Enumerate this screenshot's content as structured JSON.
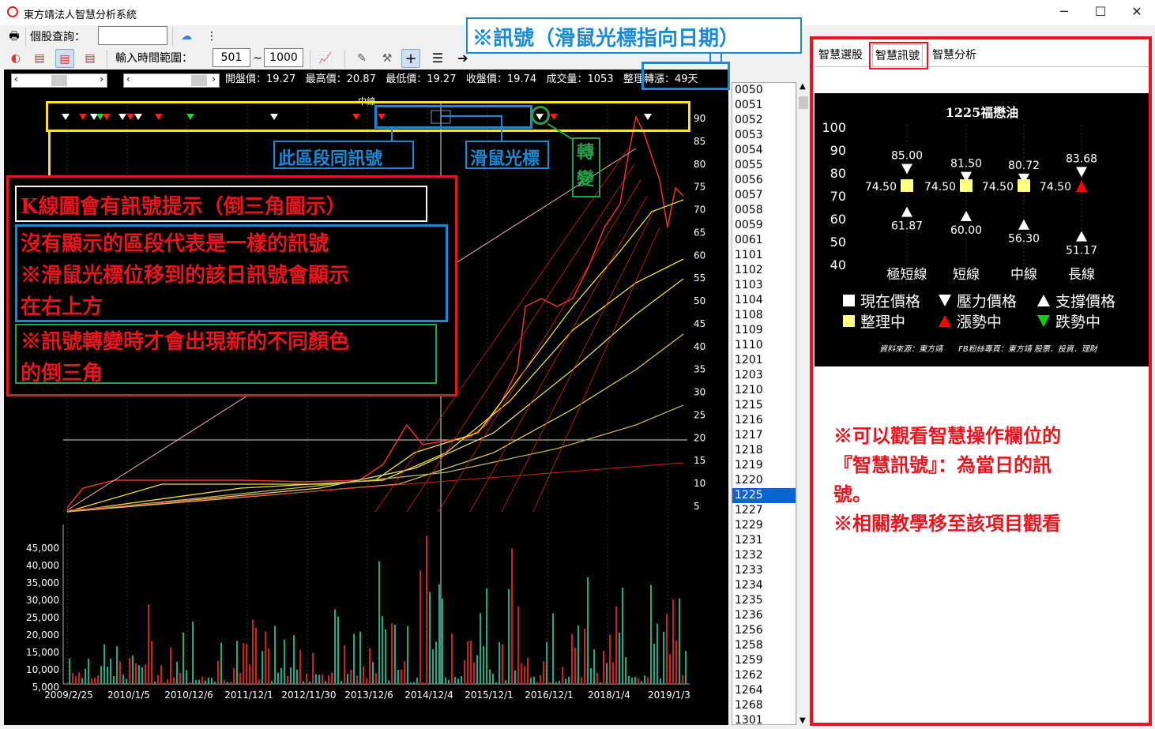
{
  "window": {
    "title": "東方靖法人智慧分析系統",
    "min": "─",
    "max": "☐",
    "close": "✕"
  },
  "toolbar": {
    "stock_query_label": "個股查詢：",
    "stock_query_value": "",
    "range_label": "輸入時間範圍：",
    "range_from": "501",
    "range_tilde": "~",
    "range_to": "1000"
  },
  "quote": {
    "open": "開盤價：19.27",
    "high": "最高價：20.87",
    "low": "最低價：19.27",
    "close": "收盤價：19.74",
    "volume": "成交量：1053",
    "consolidation": "整理轉漲：49天"
  },
  "chart": {
    "price_ticks": [
      "90",
      "85",
      "80",
      "75",
      "70",
      "65",
      "60",
      "55",
      "50",
      "45",
      "40",
      "35",
      "30",
      "25",
      "20",
      "15",
      "10",
      "5"
    ],
    "volume_ticks": [
      "45,000",
      "40,000",
      "35,000",
      "30,000",
      "25,000",
      "20,000",
      "15,000",
      "10,000",
      "5,000"
    ],
    "x_ticks": [
      "2009/2/25",
      "2010/1/5",
      "2010/12/6",
      "2011/12/1",
      "2012/11/30",
      "2013/12/6",
      "2014/12/4",
      "2015/12/1",
      "2016/12/1",
      "2018/1/4",
      "2019/1/3"
    ],
    "top_label": "中線"
  },
  "stocklist": [
    "0050",
    "0051",
    "0052",
    "0053",
    "0054",
    "0055",
    "0056",
    "0057",
    "0058",
    "0059",
    "0061",
    "1101",
    "1102",
    "1103",
    "1104",
    "1108",
    "1109",
    "1110",
    "1201",
    "1203",
    "1210",
    "1215",
    "1216",
    "1217",
    "1218",
    "1219",
    "1220",
    "1225",
    "1227",
    "1229",
    "1231",
    "1232",
    "1233",
    "1234",
    "1235",
    "1236",
    "1256",
    "1258",
    "1259",
    "1262",
    "1264",
    "1268",
    "1301"
  ],
  "stocklist_selected": "1225",
  "tabs": [
    "智慧選股",
    "智慧訊號",
    "智慧分析"
  ],
  "signal": {
    "title": "1225福懋油",
    "y_ticks": [
      "100",
      "90",
      "80",
      "70",
      "60",
      "50",
      "40"
    ],
    "columns": [
      {
        "name": "極短線",
        "resist": "85.00",
        "current": "74.50",
        "support": "61.87",
        "state": "整理中"
      },
      {
        "name": "短線",
        "resist": "81.50",
        "current": "74.50",
        "support": "60.00",
        "state": "整理中"
      },
      {
        "name": "中線",
        "resist": "80.72",
        "current": "74.50",
        "support": "56.30",
        "state": "整理中"
      },
      {
        "name": "長線",
        "resist": "83.68",
        "current": "74.50",
        "support": "51.17",
        "state": "漲勢中"
      }
    ],
    "legend": {
      "current": "現在價格",
      "resist": "壓力價格",
      "support": "支撐價格",
      "consol": "整理中",
      "up": "漲勢中",
      "down": "跌勢中"
    },
    "source": "資料來源：東方靖　　FB粉絲專頁：東方靖 股票．投資．理財"
  },
  "annotations": {
    "top_note": "※訊號（滑鼠光標指向日期）",
    "same_signal": "此區段同訊號",
    "cursor": "滑鼠光標",
    "change": "轉\n變",
    "box_title": "K線圖會有訊號提示（倒三角圖示）",
    "box_line1": "沒有顯示的區段代表是一樣的訊號",
    "box_line2": "※滑鼠光標位移到的該日訊號會顯示",
    "box_line3": "在右上方",
    "box_line4": "※訊號轉變時才會出現新的不同顏色",
    "box_line5": "的倒三角",
    "right_note1": "※可以觀看智慧操作欄位的",
    "right_note2": "『智慧訊號』：為當日的訊",
    "right_note3": "號。",
    "right_note4": "※相關教學移至該項目觀看"
  },
  "colors": {
    "annotation_red": "#e8151e",
    "annotation_blue": "#1b8ad6",
    "annotation_green": "#29a14a",
    "annotation_yellow": "#f2e130",
    "selected": "#0a64d2"
  }
}
